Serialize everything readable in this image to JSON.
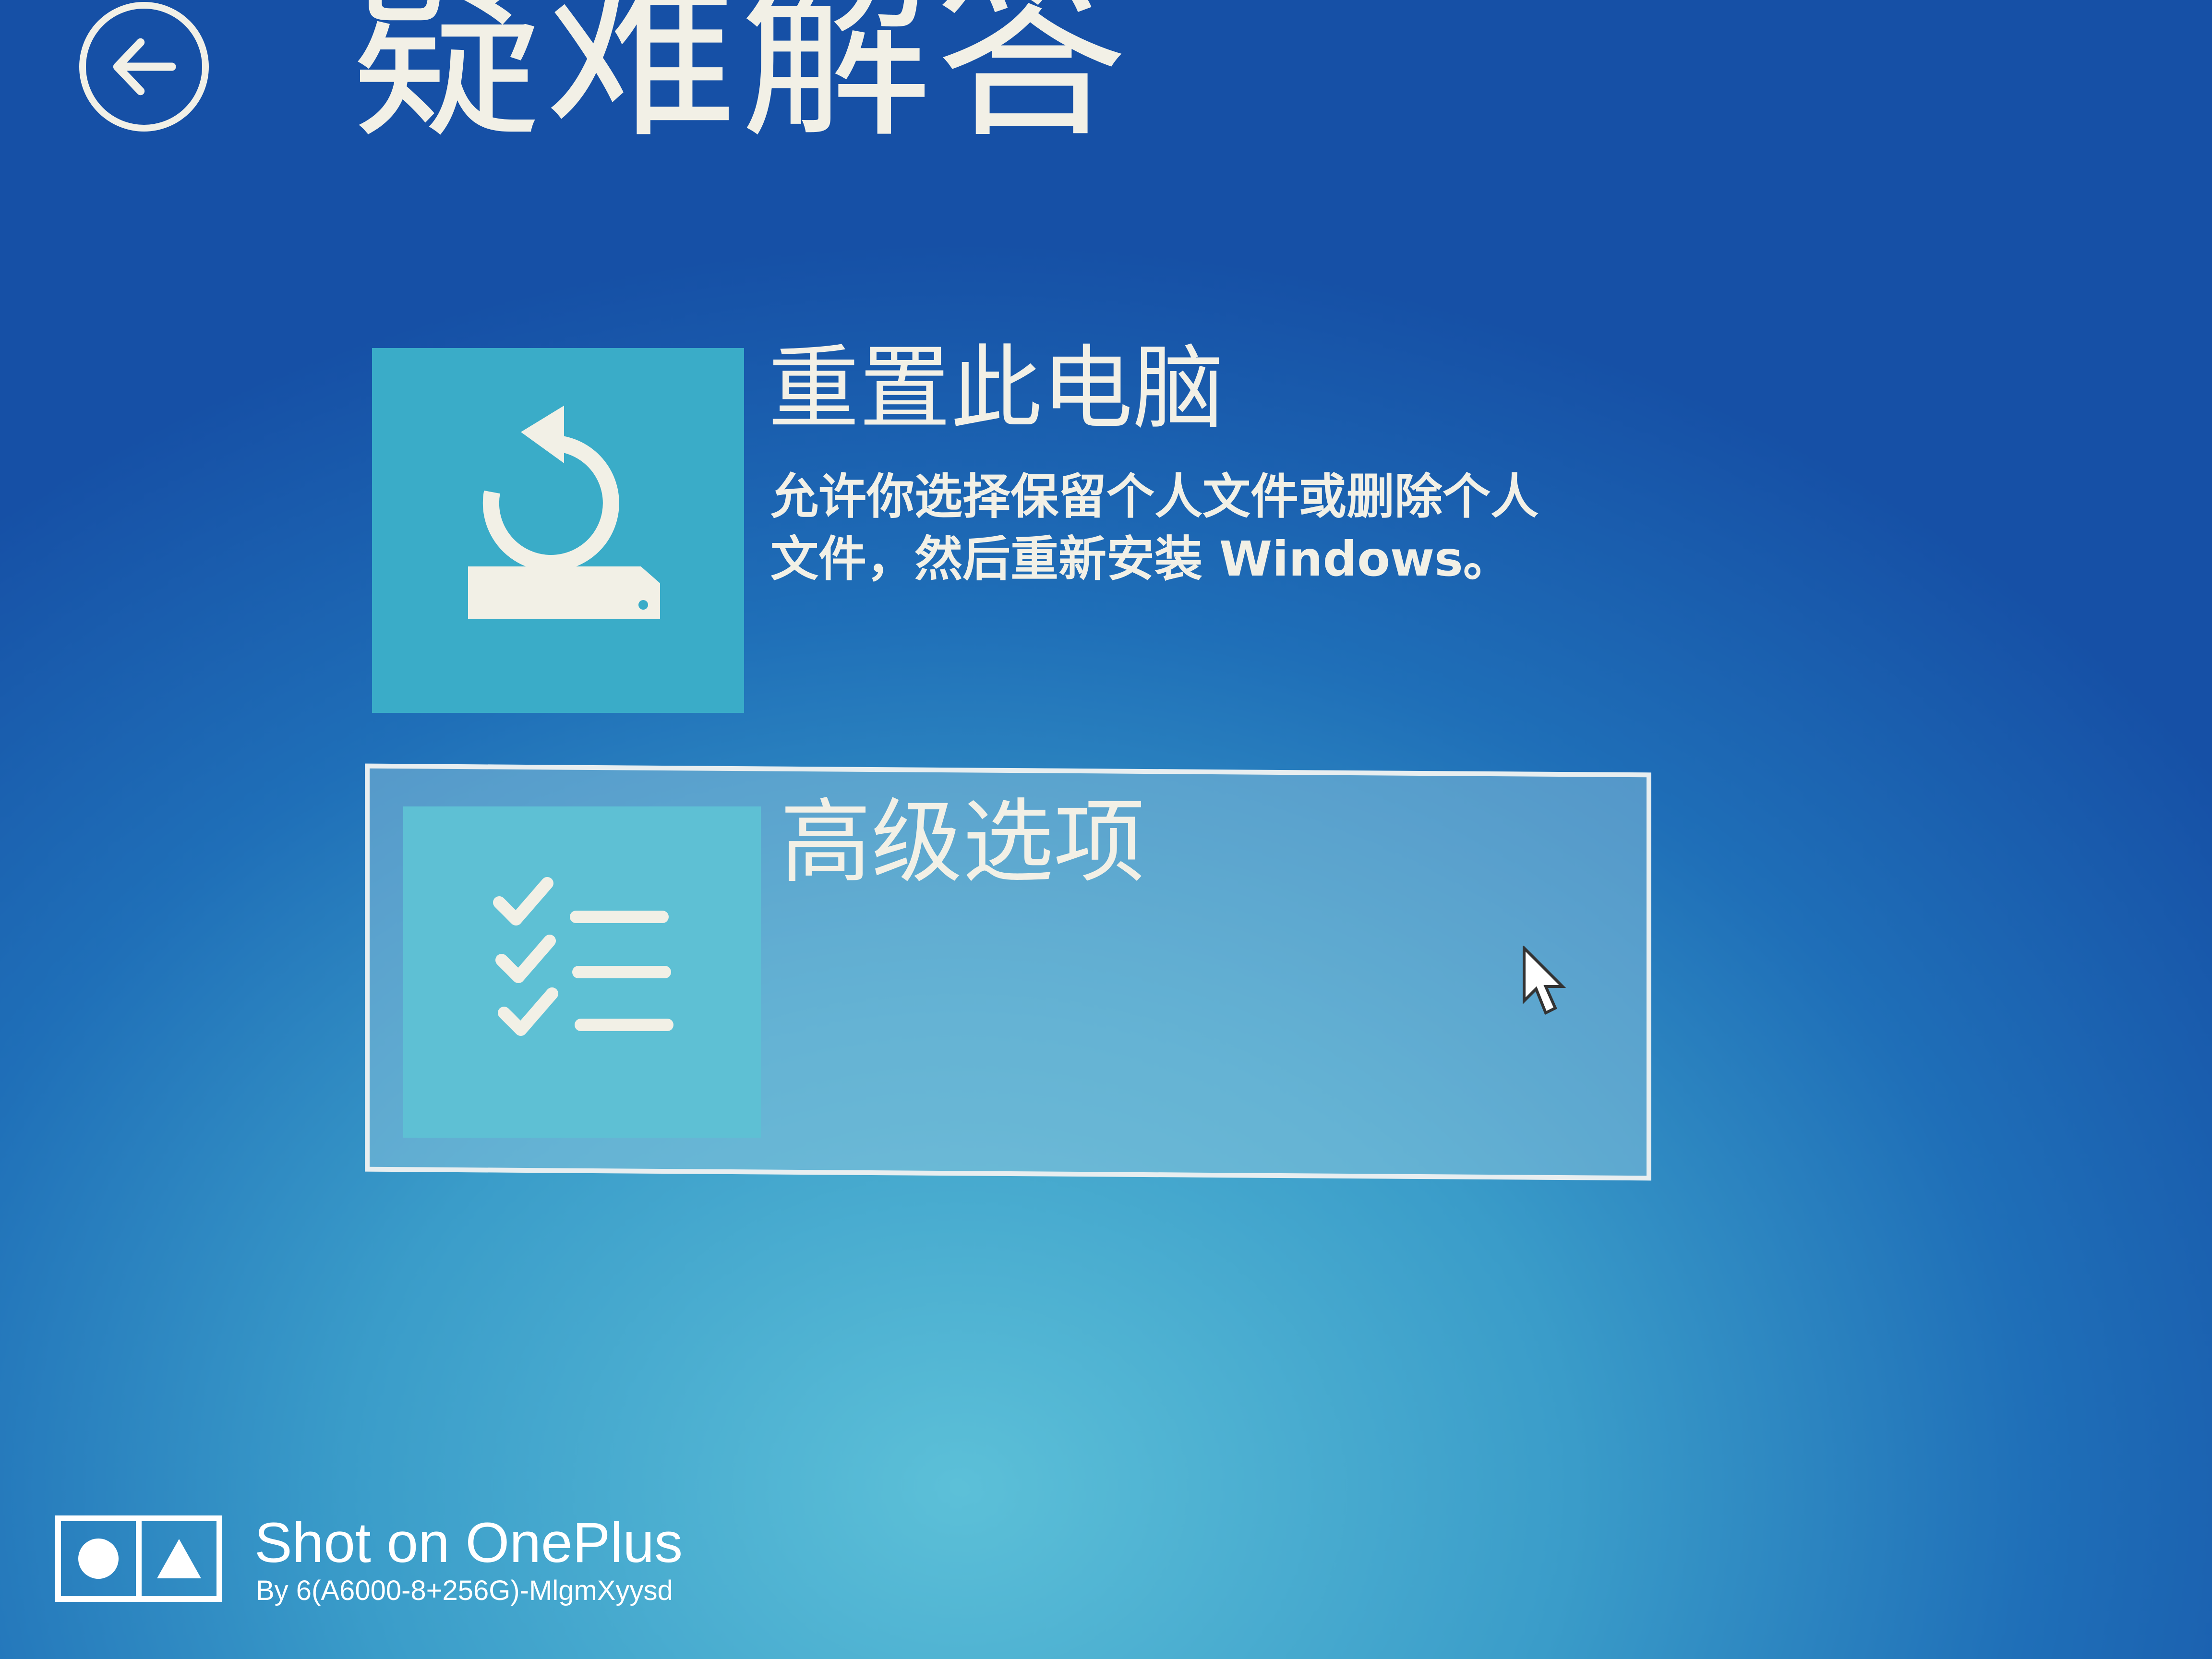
{
  "screen": {
    "title": "疑难解答",
    "back_label": "返回"
  },
  "options": [
    {
      "title": "重置此电脑",
      "description_line1": "允许你选择保留个人文件或删除个人",
      "description_line2": "文件，然后重新安装 Windows。",
      "icon": "reset-drive-icon"
    },
    {
      "title": "高级选项",
      "icon": "checklist-icon"
    }
  ],
  "watermark": {
    "title": "Shot on OnePlus",
    "subtitle": "By 6(A6000-8+256G)-MlgmXyysd"
  },
  "colors": {
    "background": "#1f6fb8",
    "tile": "#3aacc8",
    "text": "#f2f0e6"
  }
}
